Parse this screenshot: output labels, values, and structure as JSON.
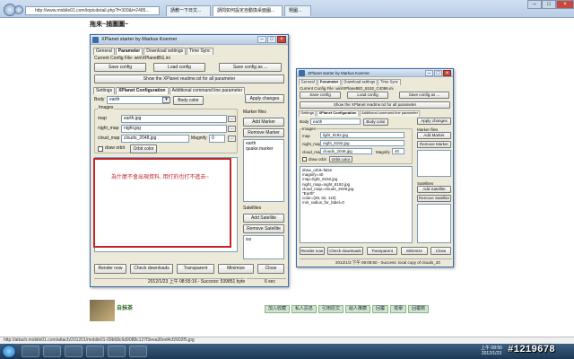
{
  "browser": {
    "url": "http://www.mobile01.com/topicdetail.php?f=300&t=2485...",
    "tab1": "請教一下日文...",
    "tab2": "請問如何設定自動換桌面圖...",
    "tab3": "題圖..."
  },
  "post": {
    "heading": "拖來~捕圖圖~",
    "annotation": "為什麼不會出現資料, 用打的也打不進去~",
    "author": "自抹茶"
  },
  "win1": {
    "title": "XPlanet starter by Markus Koerner",
    "tabs": [
      "General",
      "Parameter",
      "Download settings",
      "Time Sync"
    ],
    "config_label": "Current Config File: win\\XPlanetBG.ini",
    "save_config": "Save config",
    "load_config": "Load config",
    "save_config_as": "Save config as ...",
    "readme": "Show the XPlanet readme.txt for all parameter",
    "subtabs": [
      "Settings",
      "XPlanet Configuration",
      "Additional command line parameter"
    ],
    "apply": "Apply changes",
    "body_label": "Body",
    "body_value": "earth",
    "body_color": "Body color",
    "images_label": "Images",
    "map_label": "map",
    "map_value": "earth.jpg",
    "night_label": "night_map",
    "night_value": "night.jpg",
    "cloud_label": "cloud_map",
    "cloud_value": "clouds_2048.jpg",
    "magnify_label": "Magnify",
    "magnify_value": "0",
    "draw_orbit": "draw orbit",
    "orbit_color": "Orbit color",
    "marker_files": "Marker files",
    "add_marker": "Add Marker",
    "remove_marker": "Remove Marker",
    "markers": "earth\nquake.marker",
    "satellites": "Satellites",
    "add_satellite": "Add Satellite",
    "remove_satellite": "Remove Satellite",
    "sat_list": "iss",
    "render_now": "Render now",
    "check_downloads": "Check downloads",
    "transparent": "Transparent",
    "minimize": "Minimize",
    "close": "Close",
    "status": "2012/1/23 上午 08:55:16 - Success: 539851 byte in",
    "status2": "6 sec"
  },
  "win2": {
    "title": "XPlanet starter by Markus Koerner",
    "tabs": [
      "General",
      "Parameter",
      "Download settings",
      "Time Sync"
    ],
    "config_label": "Current Config File: win\\XPlanetBG_8192_C4096.ini",
    "save_config": "Save config",
    "load_config": "Load config",
    "save_config_as": "Save config as ...",
    "readme": "Show the XPlanet readme.txt for all parameter",
    "subtabs": [
      "Settings",
      "XPlanet Configuration",
      "Additional command line parameter"
    ],
    "apply": "Apply changes",
    "body_label": "Body",
    "body_value": "earth",
    "body_color": "Body color",
    "images_label": "Images",
    "map_label": "map",
    "map_value": "light_8192.jpg",
    "night_label": "night_map",
    "night_value": "night_8192.jpg",
    "cloud_label": "cloud_map",
    "cloud_value": "clouds_2048.jpg",
    "magnify_label": "Magnify",
    "magnify_value": "40",
    "draw_orbit": "draw orbit",
    "orbit_color": "Orbit color",
    "marker_files": "Marker files",
    "add_marker": "Add Marker",
    "remove_marker": "Remove Marker",
    "config_text": "draw_orbit=false\nmagnify=40\nmap=light_8192.jpg\nnight_map=night_8192.jpg\ncloud_map=clouds_2048.jpg\n\"Earth\"\ncolor={28, 82, 110}\nmin_radius_for_label=0",
    "satellites": "Satellites",
    "add_satellite": "Add Satellite",
    "remove_satellite": "Remove Satellite",
    "render_now": "Render now",
    "check_downloads": "Check downloads",
    "transparent": "Transparent",
    "minimize": "Minimize",
    "close": "Close",
    "status": "2012/1/3 下午 09:08:50 - Success: local copy of clouds_20"
  },
  "page_links": [
    "加入收藏",
    "私人訊息",
    "引用原文",
    "給人推薦",
    "回覆",
    "檢舉",
    "回覆數"
  ],
  "statusbar": "http://attach.mobile01.com/attach/201201/mobile01-09b68c6d9088c127f3eea36ed4cf2602f5.jpg",
  "watermark": "#1219678",
  "tray": {
    "time": "上午 08:56",
    "date": "2012/1/23"
  },
  "colors": {
    "annotation_red": "#c0262c",
    "window_border": "#3a6ea5",
    "taskbar": "#1d3856"
  }
}
